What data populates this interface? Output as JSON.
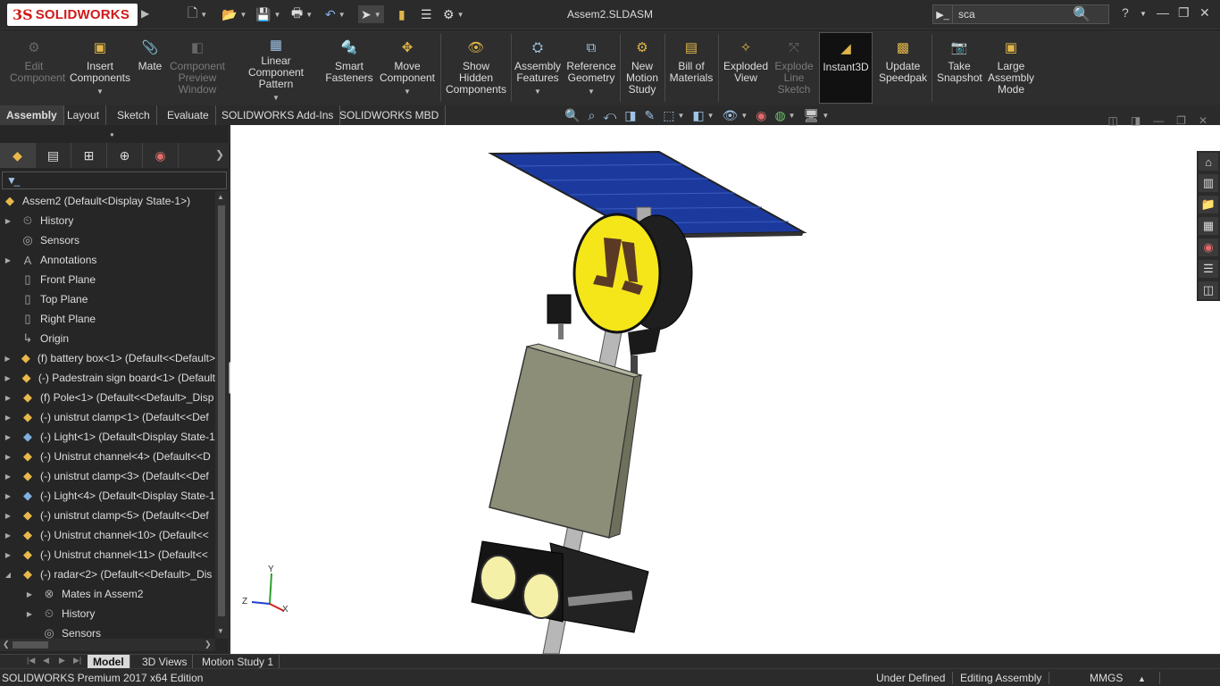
{
  "app": {
    "logo_ds": "3S",
    "logo_text": "SOLIDWORKS",
    "document_title": "Assem2.SLDASM"
  },
  "search": {
    "value": "sca",
    "command_icon": "command-prompt-icon"
  },
  "window_controls": {
    "help": "?",
    "minimize": "—",
    "restore": "❐",
    "close": "✕"
  },
  "ribbon": {
    "edit_component": "Edit Component",
    "insert_components": "Insert Components",
    "mate": "Mate",
    "component_preview": "Component Preview Window",
    "linear_pattern": "Linear Component Pattern",
    "smart_fasteners": "Smart Fasteners",
    "move_component": "Move Component",
    "show_hidden": "Show Hidden Components",
    "assembly_features": "Assembly Features",
    "reference_geometry": "Reference Geometry",
    "new_motion_study": "New Motion Study",
    "bill_of_materials": "Bill of Materials",
    "exploded_view": "Exploded View",
    "explode_line_sketch": "Explode Line Sketch",
    "instant3d": "Instant3D",
    "update_speedpak": "Update Speedpak",
    "take_snapshot": "Take Snapshot",
    "large_assembly_mode": "Large Assembly Mode"
  },
  "command_tabs": [
    "Assembly",
    "Layout",
    "Sketch",
    "Evaluate",
    "SOLIDWORKS Add-Ins",
    "SOLIDWORKS MBD"
  ],
  "tree": {
    "root": "Assem2  (Default<Display State-1>)",
    "items": [
      "History",
      "Sensors",
      "Annotations",
      "Front Plane",
      "Top Plane",
      "Right Plane",
      "Origin",
      "(f) battery box<1> (Default<<Default>",
      "(-) Padestrain sign board<1> (Default",
      "(f) Pole<1> (Default<<Default>_Disp",
      "(-) unistrut clamp<1> (Default<<Def",
      "(-) Light<1> (Default<Display State-1",
      "(-) Unistrut channel<4> (Default<<D",
      "(-) unistrut clamp<3> (Default<<Def",
      "(-) Light<4> (Default<Display State-1",
      "(-) unistrut clamp<5> (Default<<Def",
      "(-) Unistrut channel<10> (Default<<",
      "(-) Unistrut channel<11> (Default<<",
      "(-) radar<2> (Default<<Default>_Dis",
      "Mates in Assem2",
      "History",
      "Sensors"
    ]
  },
  "triad": {
    "x": "X",
    "y": "Y",
    "z": "Z"
  },
  "bottom_tabs": [
    "Model",
    "3D Views",
    "Motion Study 1"
  ],
  "status": {
    "edition": "SOLIDWORKS Premium 2017 x64 Edition",
    "defined": "Under Defined",
    "mode": "Editing Assembly",
    "units": "MMGS",
    "units_caret": "▲"
  },
  "colors": {
    "accent_red": "#d01a1a",
    "sign_yellow": "#f5e61a",
    "solar_blue": "#1c3a9e",
    "box_gray": "#8c8e78"
  }
}
